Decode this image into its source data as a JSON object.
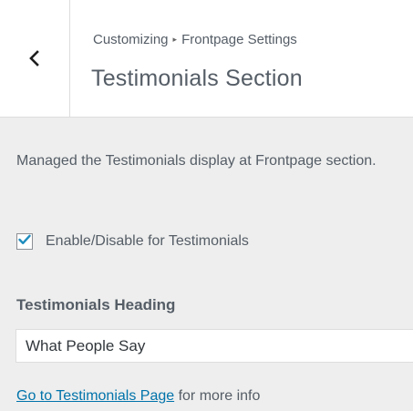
{
  "header": {
    "back_icon": "chevron-left-icon",
    "breadcrumb": {
      "parent": "Customizing",
      "separator": "▸",
      "section": "Frontpage Settings"
    },
    "title": "Testimonials Section"
  },
  "section": {
    "description": "Managed the Testimonials display at Frontpage section.",
    "enable_checkbox": {
      "label": "Enable/Disable for Testimonials",
      "checked": true
    },
    "heading_field": {
      "label": "Testimonials Heading",
      "value": "What People Say"
    },
    "info": {
      "link_text": "Go to Testimonials Page",
      "suffix": " for more info"
    }
  },
  "colors": {
    "accent": "#0073aa",
    "panel_bg": "#eeeeee",
    "header_bg": "#ffffff"
  }
}
